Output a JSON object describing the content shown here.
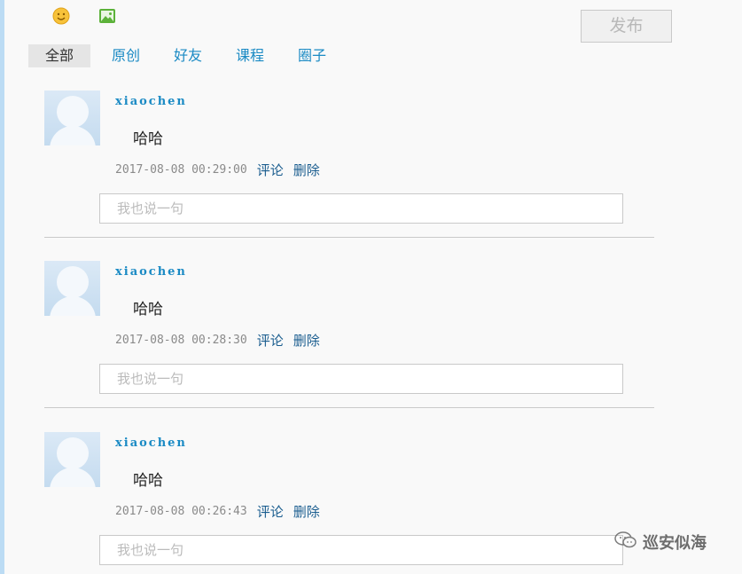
{
  "toolbar": {
    "emoji_icon": "smiley-face-icon",
    "image_icon": "picture-icon",
    "publish_label": "发布"
  },
  "tabs": [
    {
      "label": "全部",
      "active": true
    },
    {
      "label": "原创",
      "active": false
    },
    {
      "label": "好友",
      "active": false
    },
    {
      "label": "课程",
      "active": false
    },
    {
      "label": "圈子",
      "active": false
    }
  ],
  "posts": [
    {
      "username": "xiaochen",
      "content": "哈哈",
      "timestamp": "2017-08-08 00:29:00",
      "comment_label": "评论",
      "delete_label": "删除",
      "reply_placeholder": "我也说一句"
    },
    {
      "username": "xiaochen",
      "content": "哈哈",
      "timestamp": "2017-08-08 00:28:30",
      "comment_label": "评论",
      "delete_label": "删除",
      "reply_placeholder": "我也说一句"
    },
    {
      "username": "xiaochen",
      "content": "哈哈",
      "timestamp": "2017-08-08 00:26:43",
      "comment_label": "评论",
      "delete_label": "删除",
      "reply_placeholder": "我也说一句"
    }
  ],
  "watermark": {
    "text": "巡安似海",
    "icon": "wechat-icon"
  },
  "colors": {
    "accent": "#1a8ac4",
    "link": "#1a5d8f",
    "left_bar": "#bcdcf4"
  }
}
